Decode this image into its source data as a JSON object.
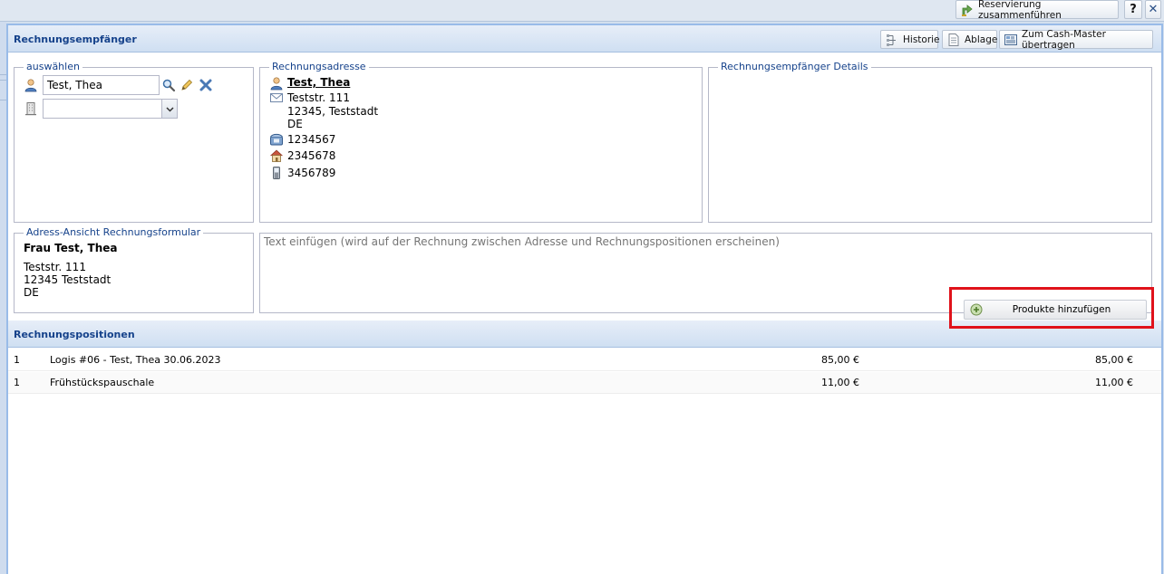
{
  "topbar": {
    "merge_label": "Reservierung zusammenführen",
    "help_label": "?",
    "close_label": "✕"
  },
  "recipient_panel": {
    "title": "Rechnungsempfänger",
    "buttons": {
      "history": "Historie",
      "archive": "Ablage",
      "cash_master": "Zum Cash-Master übertragen"
    },
    "select": {
      "legend": "auswählen",
      "person_value": "Test, Thea",
      "company_value": ""
    },
    "address": {
      "legend": "Rechnungsadresse",
      "name": "Test, Thea",
      "street": "Teststr. 111",
      "city": "12345, Teststadt",
      "country": "DE",
      "phone": "1234567",
      "phone_private": "2345678",
      "mobile": "3456789"
    },
    "details": {
      "legend": "Rechnungsempfänger Details"
    },
    "form_view": {
      "legend": "Adress-Ansicht Rechnungsformular",
      "name": "Frau Test, Thea",
      "street": "Teststr. 111",
      "city": "12345 Teststadt",
      "country": "DE"
    },
    "insert_text": {
      "placeholder": "Text einfügen (wird auf der Rechnung zwischen Adresse und Rechnungspositionen erscheinen)"
    }
  },
  "positions_panel": {
    "title": "Rechnungspositionen",
    "add_button": "Produkte hinzufügen",
    "rows": [
      {
        "qty": "1",
        "description": "Logis #06 - Test, Thea 30.06.2023",
        "price": "85,00 €",
        "total": "85,00 €"
      },
      {
        "qty": "1",
        "description": "Frühstückspauschale",
        "price": "11,00 €",
        "total": "11,00 €"
      }
    ]
  },
  "colors": {
    "header_text": "#15428b",
    "highlight": "#e0121b",
    "panel_border": "#99bbe8"
  }
}
